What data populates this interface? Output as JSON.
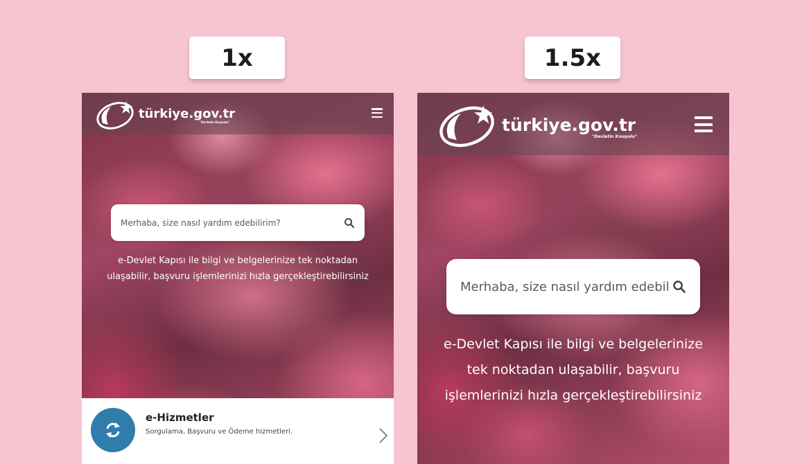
{
  "zoom_labels": [
    "1x",
    "1.5x"
  ],
  "logo": {
    "text": "türkiye.gov.tr",
    "subtitle": "\"Devletin Kısayolu\""
  },
  "search": {
    "placeholder_1x": "Merhaba, size nasıl yardım edebilirim?",
    "placeholder_15x": "Merhaba, size nasıl yardım edebil"
  },
  "tagline_1x": [
    "e-Devlet Kapısı ile bilgi ve belgelerinize tek noktadan",
    "ulaşabilir, başvuru işlemlerinizi hızla gerçekleştirebilirsiniz"
  ],
  "tagline_15x": [
    "e-Devlet Kapısı ile bilgi ve belgelerinize",
    "tek noktadan ulaşabilir, başvuru",
    "işlemlerinizi hızla gerçekleştirebilirsiniz"
  ],
  "card": {
    "title": "e-Hizmetler",
    "description": "Sorgulama, Başvuru ve Ödeme hizmetleri."
  },
  "icons": [
    "crescent-star-logo-icon",
    "menu-icon",
    "search-icon",
    "refresh-icon",
    "chevron-right-icon"
  ],
  "colors": {
    "background": "#f7c5d2",
    "card_icon": "#2f7cad",
    "header": "#64464f"
  }
}
